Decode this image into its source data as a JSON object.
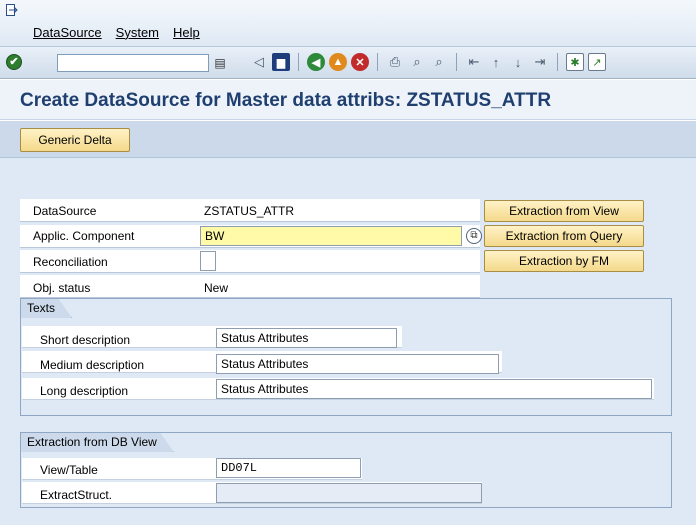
{
  "menu": {
    "items": [
      "DataSource",
      "System",
      "Help"
    ]
  },
  "toolbar": {
    "command_value": "",
    "icons": [
      "enter-icon",
      "back-icon",
      "save-icon",
      "back-green-icon",
      "exit-icon",
      "cancel-icon",
      "print-icon",
      "find-icon",
      "find-next-icon",
      "first-page-icon",
      "prev-page-icon",
      "next-page-icon",
      "last-page-icon",
      "create-session-icon",
      "layout-icon"
    ]
  },
  "title": "Create DataSource for Master data attribs: ZSTATUS_ATTR",
  "app_toolbar": {
    "generic_delta_label": "Generic Delta"
  },
  "form": {
    "datasource_label": "DataSource",
    "datasource_value": "ZSTATUS_ATTR",
    "applic_component_label": "Applic. Component",
    "applic_component_value": "BW",
    "reconciliation_label": "Reconciliation",
    "obj_status_label": "Obj. status",
    "obj_status_value": "New"
  },
  "side_buttons": {
    "from_view": "Extraction from View",
    "from_query": "Extraction from Query",
    "by_fm": "Extraction by FM"
  },
  "texts_group": {
    "title": "Texts",
    "short_label": "Short description",
    "short_value": "Status Attributes",
    "medium_label": "Medium description",
    "medium_value": "Status Attributes",
    "long_label": "Long description",
    "long_value": "Status Attributes"
  },
  "db_view_group": {
    "title": "Extraction from DB View",
    "view_table_label": "View/Table",
    "view_table_value": "DD07L",
    "extract_struct_label": "ExtractStruct.",
    "extract_struct_value": ""
  },
  "colors": {
    "title": "#1f3f70",
    "button_face": "#f4d98a",
    "required_field": "#fffaa8",
    "panel": "#dfe9f5"
  }
}
